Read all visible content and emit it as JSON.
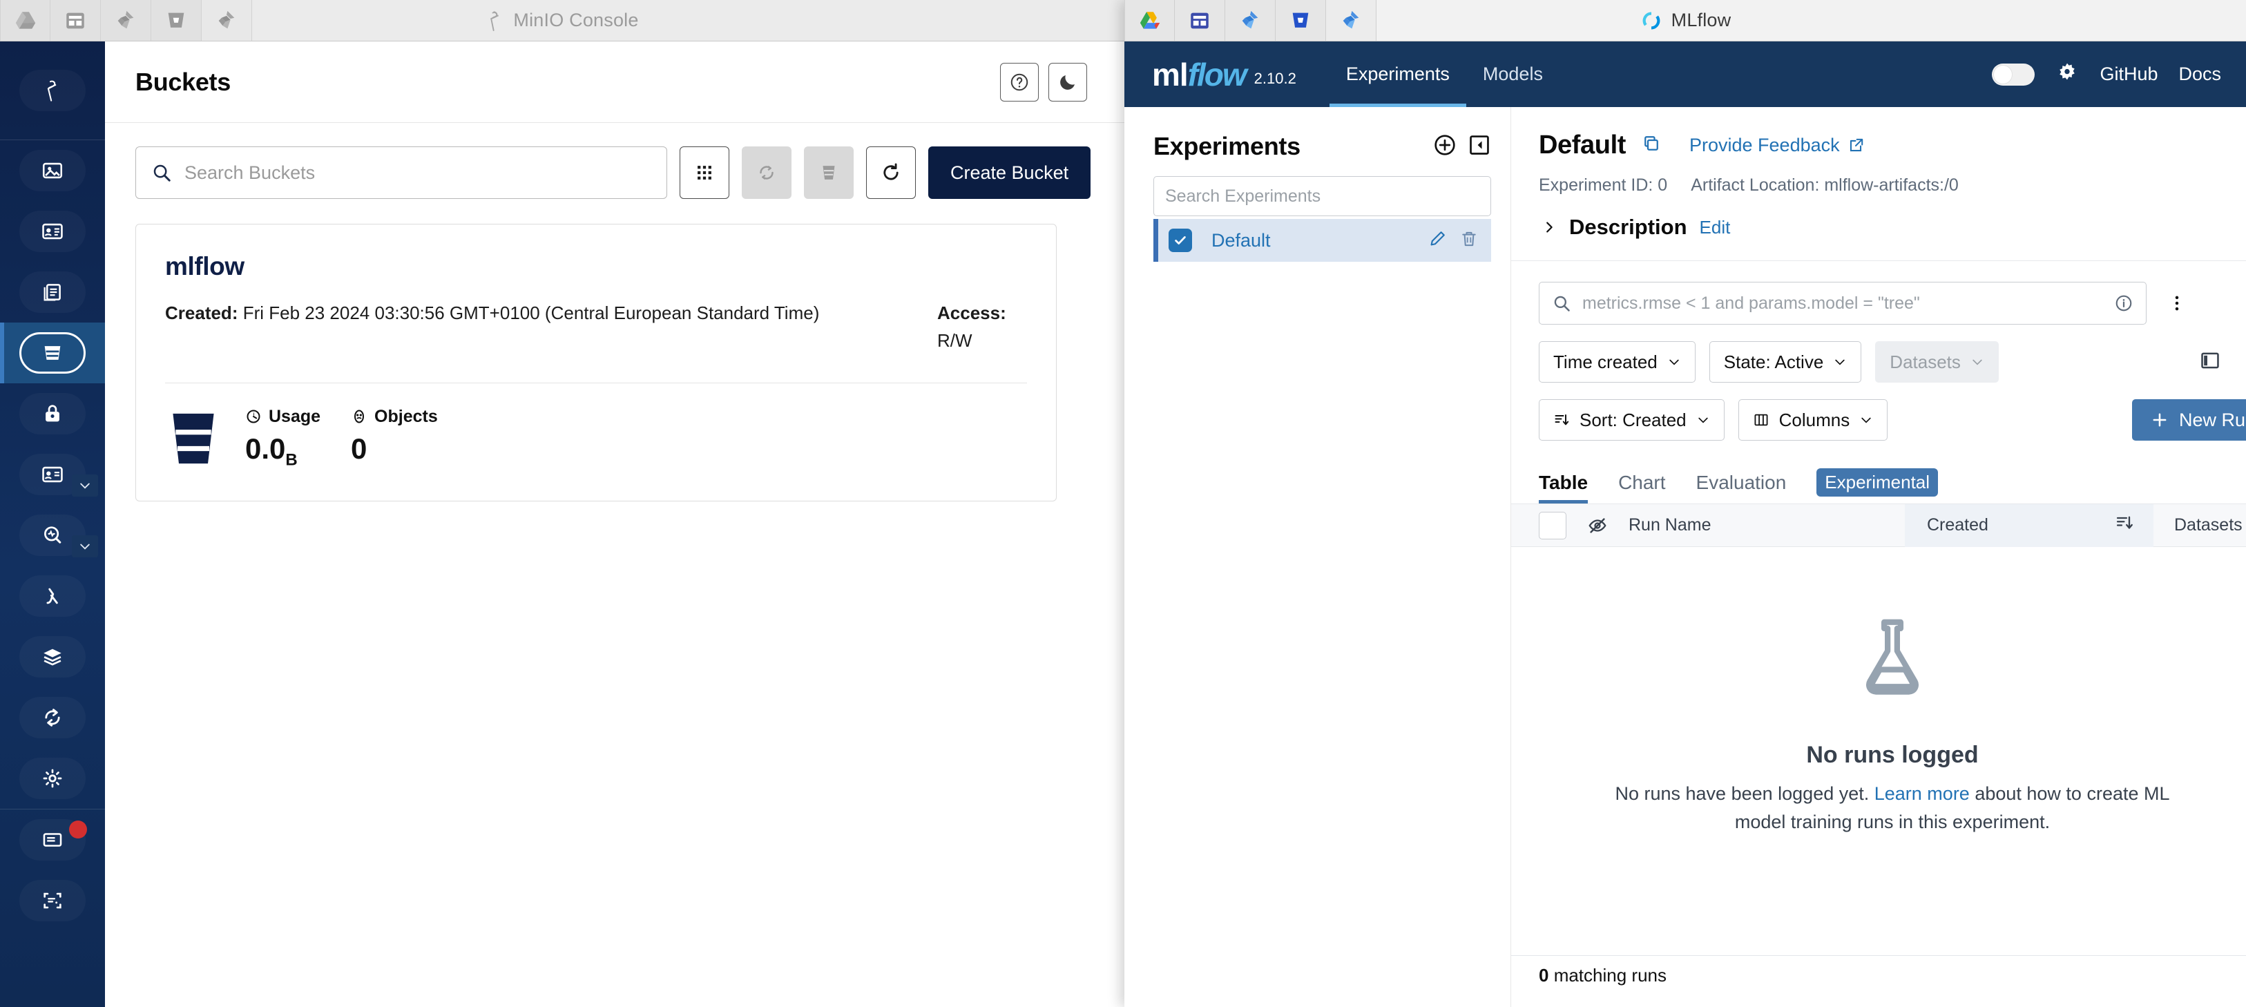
{
  "minio_window": {
    "title": "MinIO Console",
    "tabs": [
      "drive-icon",
      "confluence-icon",
      "jira-icon",
      "bitbucket-icon",
      "jira-icon"
    ],
    "rail": {
      "logo": "minio-logo-icon",
      "items": [
        {
          "name": "dashboard",
          "icon": "image-icon"
        },
        {
          "name": "identity",
          "icon": "id-card-icon"
        },
        {
          "name": "access",
          "icon": "documents-icon"
        },
        {
          "name": "buckets",
          "icon": "bucket-icon",
          "selected": true
        },
        {
          "name": "object-browser",
          "icon": "lock-icon"
        },
        {
          "name": "users",
          "icon": "contact-card-icon",
          "chevron": true
        },
        {
          "name": "monitoring",
          "icon": "monitoring-icon",
          "chevron": true
        },
        {
          "name": "lambda",
          "icon": "lambda-icon"
        },
        {
          "name": "tiering",
          "icon": "layers-icon"
        },
        {
          "name": "replication",
          "icon": "sync-icon"
        },
        {
          "name": "settings",
          "icon": "gear-icon"
        },
        {
          "name": "license",
          "icon": "notes-icon",
          "badge": true
        },
        {
          "name": "subnet",
          "icon": "register-icon"
        }
      ]
    },
    "page_title": "Buckets",
    "header_buttons": [
      {
        "name": "help",
        "icon": "question-circle-icon"
      },
      {
        "name": "theme",
        "icon": "moon-icon"
      }
    ],
    "search": {
      "placeholder": "Search Buckets",
      "value": ""
    },
    "toolbar_buttons": [
      {
        "name": "grid-view",
        "icon": "grid-icon",
        "disabled": false
      },
      {
        "name": "lifecycle",
        "icon": "refresh-cycle-icon",
        "disabled": true
      },
      {
        "name": "delete-selected",
        "icon": "bucket-delete-icon",
        "disabled": true
      },
      {
        "name": "refresh",
        "icon": "reload-icon",
        "disabled": false
      }
    ],
    "create_bucket_label": "Create Bucket",
    "bucket": {
      "name": "mlflow",
      "created_label": "Created:",
      "created_value": "Fri Feb 23 2024 03:30:56 GMT+0100 (Central European Standard Time)",
      "access_label": "Access:",
      "access_value": "R/W",
      "usage_label": "Usage",
      "usage_value": "0.0",
      "usage_unit": "B",
      "objects_label": "Objects",
      "objects_value": "0"
    }
  },
  "mlflow_window": {
    "title": "MLflow",
    "tabs": [
      "drive-icon",
      "confluence-icon",
      "jira-icon",
      "bitbucket-icon",
      "jira-icon"
    ],
    "header": {
      "logo_ml": "ml",
      "logo_flow": "flow",
      "version": "2.10.2",
      "nav": [
        {
          "label": "Experiments",
          "active": true
        },
        {
          "label": "Models",
          "active": false
        }
      ],
      "dark_toggle": "theme-toggle",
      "gear": "gear-icon",
      "links": [
        {
          "label": "GitHub"
        },
        {
          "label": "Docs"
        }
      ]
    },
    "sidebar": {
      "title": "Experiments",
      "new_icon": "plus-circle-icon",
      "collapse_icon": "collapse-panel-icon",
      "search": {
        "placeholder": "Search Experiments",
        "value": ""
      },
      "items": [
        {
          "name": "Default",
          "selected": true,
          "edit_icon": "pencil-icon",
          "delete_icon": "trash-icon"
        }
      ]
    },
    "main": {
      "experiment_name": "Default",
      "copy_icon": "copy-icon",
      "feedback_label": "Provide Feedback",
      "feedback_icon": "external-link-icon",
      "experiment_id": "Experiment ID: 0",
      "artifact_location": "Artifact Location: mlflow-artifacts:/0",
      "description_label": "Description",
      "description_edit": "Edit",
      "query": {
        "placeholder": "metrics.rmse < 1 and params.model = \"tree\"",
        "value": "",
        "info_icon": "info-circle-icon",
        "kebab_icon": "more-vertical-icon"
      },
      "filters": [
        {
          "label": "Time created",
          "muted": false
        },
        {
          "label": "State: Active",
          "muted": false
        },
        {
          "label": "Datasets",
          "muted": true
        }
      ],
      "panel_icon": "side-panel-icon",
      "sort_label": "Sort: Created",
      "columns_label": "Columns",
      "new_run_label": "New Run",
      "tabs": [
        {
          "label": "Table",
          "active": true,
          "badge": false
        },
        {
          "label": "Chart",
          "active": false,
          "badge": false
        },
        {
          "label": "Evaluation",
          "active": false,
          "badge": false
        },
        {
          "label": "Experimental",
          "active": false,
          "badge": true
        }
      ],
      "table_headers": {
        "select_all": "select-all-checkbox",
        "visibility": "eye-off-icon",
        "run_name": "Run Name",
        "created": "Created",
        "sort_icon": "sort-desc-icon",
        "datasets": "Datasets"
      },
      "empty_state": {
        "icon": "flask-icon",
        "heading": "No runs logged",
        "text_before": "No runs have been logged yet. ",
        "link": "Learn more",
        "text_after": " about how to create ML model training runs in this experiment."
      },
      "footer_count": "0",
      "footer_label": " matching runs"
    },
    "accent_blue": "#4276ad",
    "header_navy": "#17375e",
    "link_blue": "#2272b4"
  }
}
